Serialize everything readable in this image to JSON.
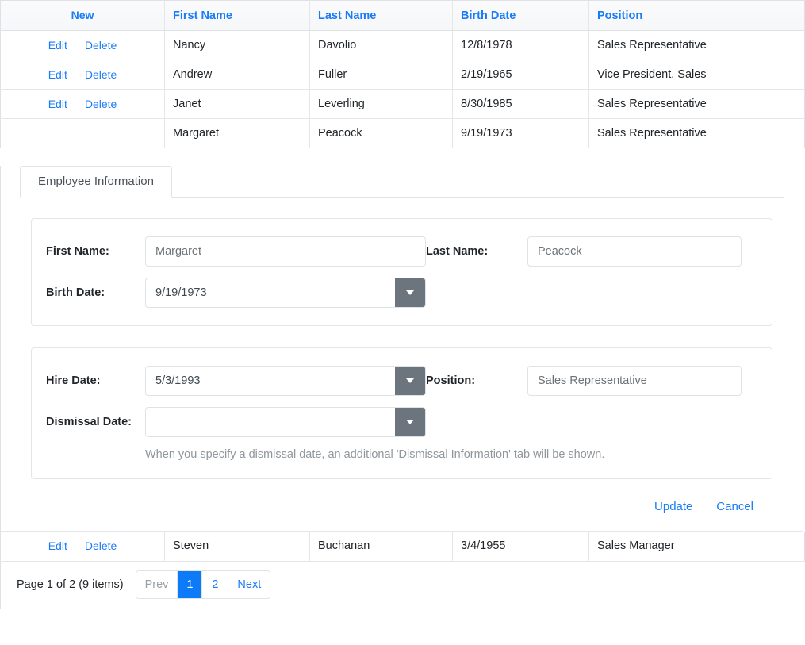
{
  "grid": {
    "columns": [
      "",
      "First Name",
      "Last Name",
      "Birth Date",
      "Position"
    ],
    "new_label": "New",
    "edit_label": "Edit",
    "delete_label": "Delete",
    "rows_top": [
      {
        "first_name": "Nancy",
        "last_name": "Davolio",
        "birth_date": "12/8/1978",
        "position": "Sales Representative",
        "editing": false
      },
      {
        "first_name": "Andrew",
        "last_name": "Fuller",
        "birth_date": "2/19/1965",
        "position": "Vice President, Sales",
        "editing": false
      },
      {
        "first_name": "Janet",
        "last_name": "Leverling",
        "birth_date": "8/30/1985",
        "position": "Sales Representative",
        "editing": false
      },
      {
        "first_name": "Margaret",
        "last_name": "Peacock",
        "birth_date": "9/19/1973",
        "position": "Sales Representative",
        "editing": true
      }
    ],
    "rows_bottom": [
      {
        "first_name": "Steven",
        "last_name": "Buchanan",
        "birth_date": "3/4/1955",
        "position": "Sales Manager",
        "editing": false
      }
    ]
  },
  "editor": {
    "tabs": [
      {
        "label": "Employee Information",
        "active": true
      }
    ],
    "panel1": {
      "first_name_label": "First Name:",
      "first_name_value": "Margaret",
      "last_name_label": "Last Name:",
      "last_name_value": "Peacock",
      "birth_date_label": "Birth Date:",
      "birth_date_value": "9/19/1973"
    },
    "panel2": {
      "hire_date_label": "Hire Date:",
      "hire_date_value": "5/3/1993",
      "position_label": "Position:",
      "position_value": "Sales Representative",
      "dismissal_date_label": "Dismissal Date:",
      "dismissal_date_value": "",
      "hint": "When you specify a dismissal date, an additional 'Dismissal Information' tab will be shown."
    },
    "update_label": "Update",
    "cancel_label": "Cancel"
  },
  "pager": {
    "info": "Page 1 of 2 (9 items)",
    "prev_label": "Prev",
    "next_label": "Next",
    "pages": [
      "1",
      "2"
    ],
    "active_page": "1"
  },
  "colors": {
    "link_blue": "#1a7bf7",
    "active_page_bg": "#0d7bf7",
    "dropdown_button": "#6c757d",
    "border": "#dee2e6"
  }
}
